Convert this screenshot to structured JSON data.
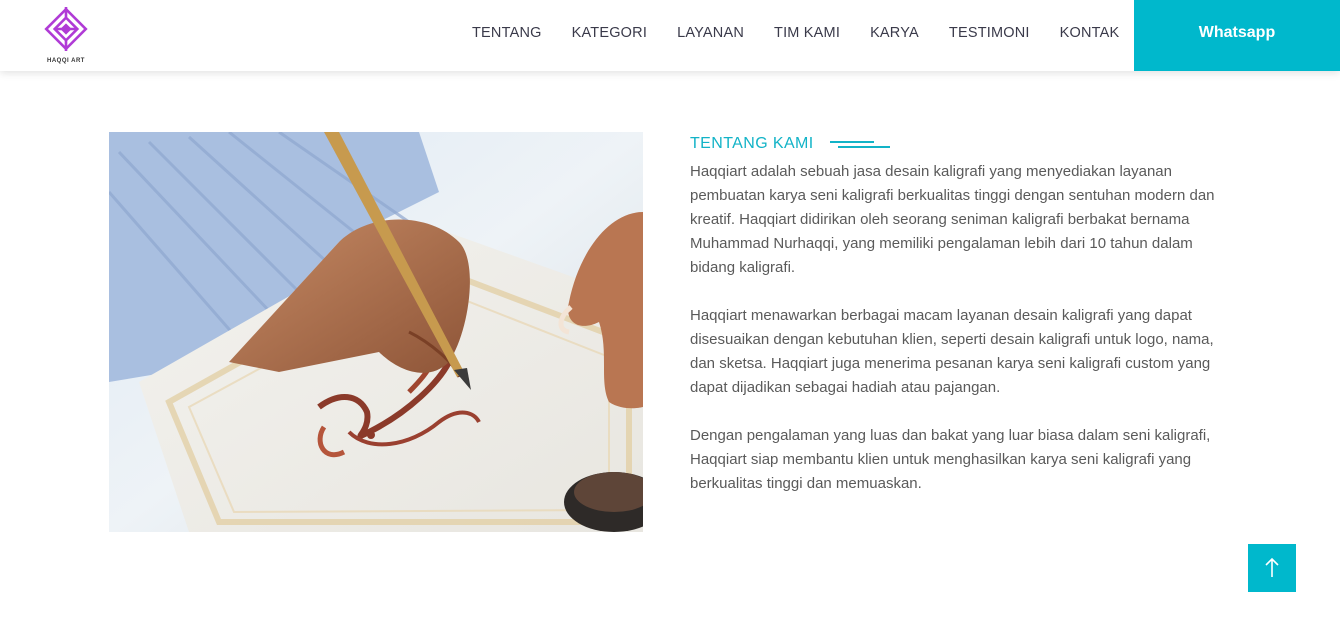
{
  "brand": {
    "logo_text": "HAQQI ART",
    "accent": "#00b8cc",
    "logo_color": "#b03bd6"
  },
  "nav": {
    "items": [
      {
        "label": "TENTANG"
      },
      {
        "label": "KATEGORI"
      },
      {
        "label": "LAYANAN"
      },
      {
        "label": "TIM KAMI"
      },
      {
        "label": "KARYA"
      },
      {
        "label": "TESTIMONI"
      },
      {
        "label": "KONTAK"
      }
    ],
    "cta_label": "Whatsapp"
  },
  "about": {
    "title": "TENTANG KAMI",
    "paragraphs": [
      "Haqqiart adalah sebuah jasa desain kaligrafi yang menyediakan layanan pembuatan karya seni kaligrafi berkualitas tinggi dengan sentuhan modern dan kreatif. Haqqiart didirikan oleh seorang seniman kaligrafi berbakat bernama Muhammad Nurhaqqi, yang memiliki pengalaman lebih dari 10 tahun dalam bidang kaligrafi.",
      "Haqqiart menawarkan berbagai macam layanan desain kaligrafi yang dapat disesuaikan dengan kebutuhan klien, seperti desain kaligrafi untuk logo, nama, dan sketsa. Haqqiart juga menerima pesanan karya seni kaligrafi custom yang dapat dijadikan sebagai hadiah atau pajangan.",
      "Dengan pengalaman yang luas dan bakat yang luar biasa dalam seni kaligrafi, Haqqiart siap membantu klien untuk menghasilkan karya seni kaligrafi yang berkualitas tinggi dan memuaskan."
    ]
  },
  "icons": {
    "scroll_top": "arrow-up-icon"
  }
}
